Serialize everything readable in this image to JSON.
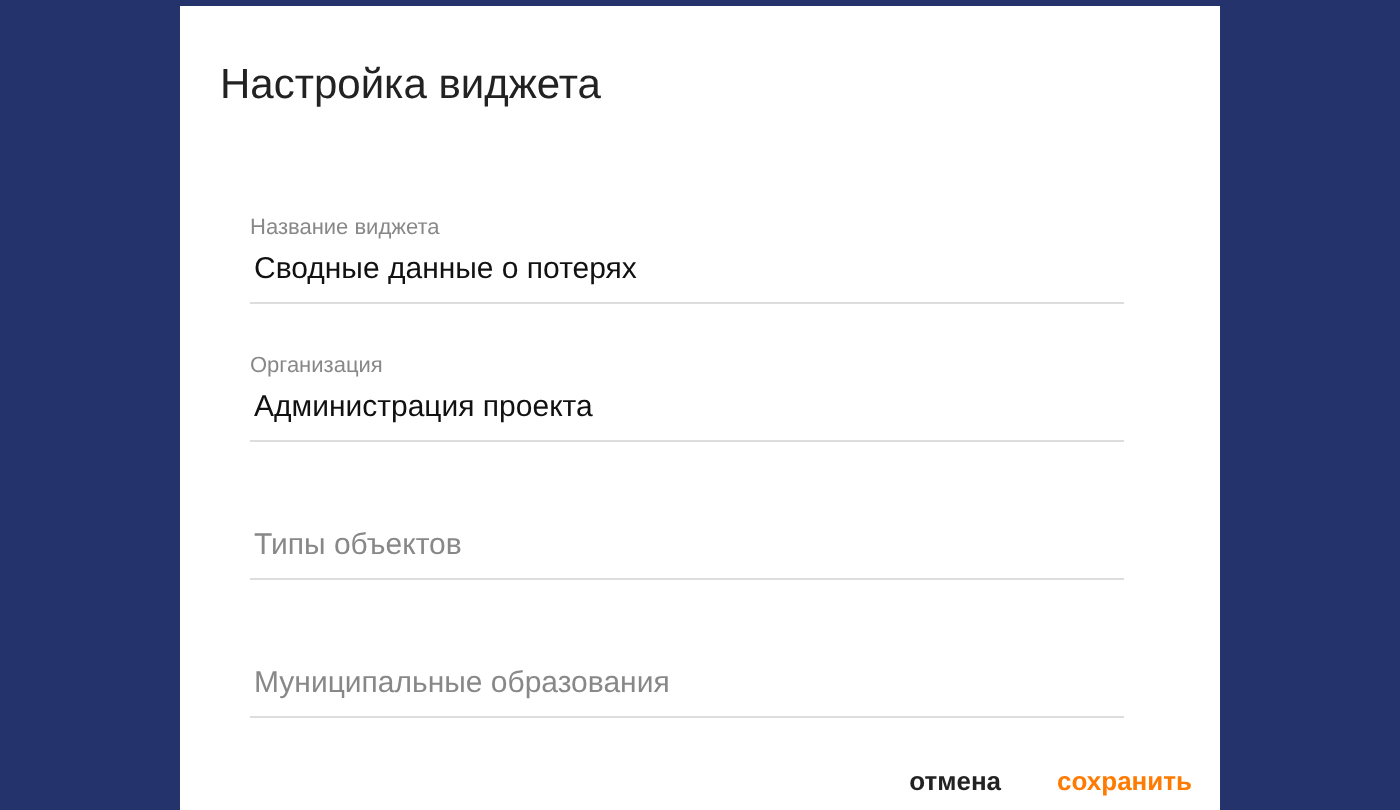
{
  "dialog": {
    "title": "Настройка виджета",
    "fields": [
      {
        "label": "Название виджета",
        "value": "Сводные данные о потерях"
      },
      {
        "label": "Организация",
        "value": "Администрация проекта"
      },
      {
        "placeholder": "Типы объектов"
      },
      {
        "placeholder": "Муниципальные образования"
      }
    ],
    "buttons": [
      {
        "label": "отмена",
        "kind": "secondary"
      },
      {
        "label": "сохранить",
        "kind": "primary"
      }
    ]
  }
}
